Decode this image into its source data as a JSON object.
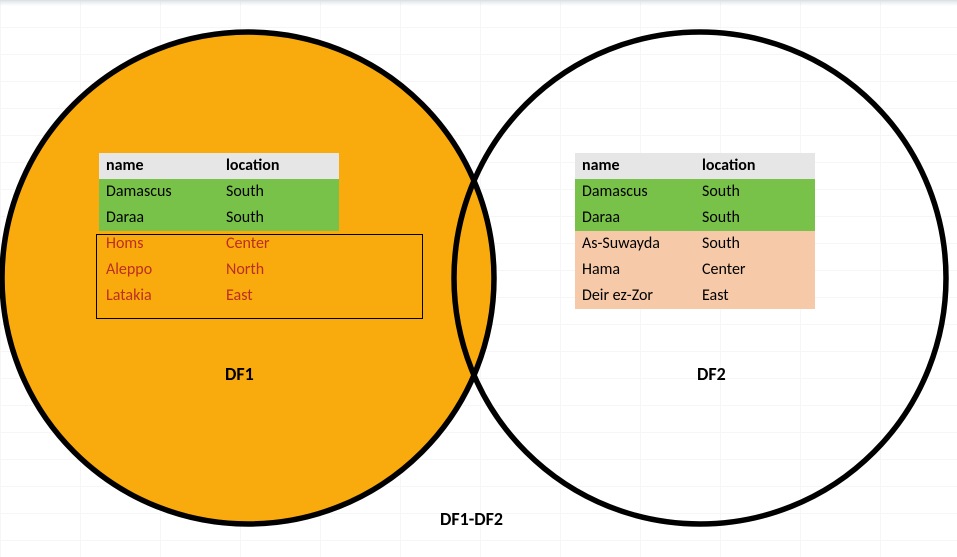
{
  "venn": {
    "left_label": "DF1",
    "right_label": "DF2",
    "center_label": "DF1-DF2",
    "left_fill": "#f9aa0c",
    "stroke": "#000000"
  },
  "columns": {
    "name": "name",
    "location": "location"
  },
  "df1": {
    "common": [
      {
        "name": "Damascus",
        "location": "South"
      },
      {
        "name": "Daraa",
        "location": "South"
      }
    ],
    "unique": [
      {
        "name": "Homs",
        "location": "Center"
      },
      {
        "name": "Aleppo",
        "location": "North"
      },
      {
        "name": "Latakia",
        "location": "East"
      }
    ]
  },
  "df2": {
    "common": [
      {
        "name": "Damascus",
        "location": "South"
      },
      {
        "name": "Daraa",
        "location": "South"
      }
    ],
    "unique": [
      {
        "name": "As-Suwayda",
        "location": "South"
      },
      {
        "name": "Hama",
        "location": "Center"
      },
      {
        "name": "Deir ez-Zor",
        "location": "East"
      }
    ]
  },
  "colors": {
    "header_bg": "#e6e6e6",
    "common_bg": "#79c24a",
    "right_unique_bg": "#f6c9a9",
    "left_unique_text": "#ba2f20"
  }
}
